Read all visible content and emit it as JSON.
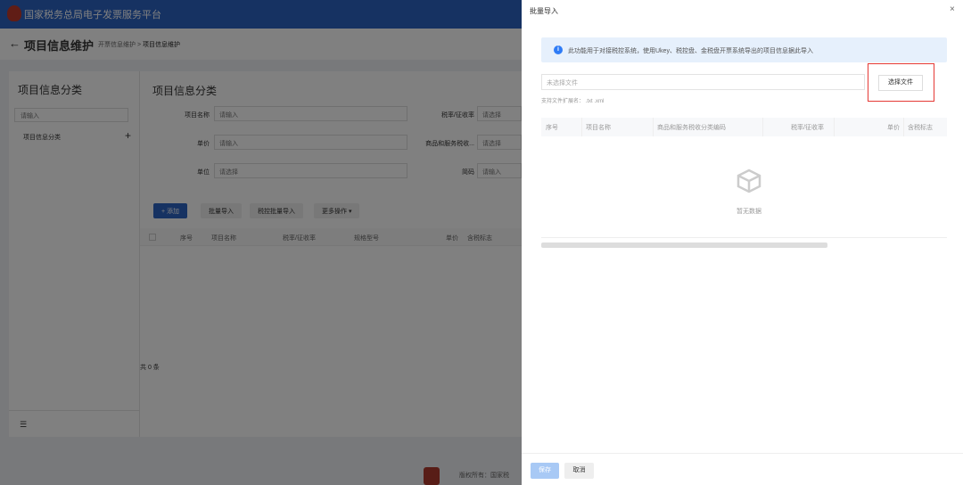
{
  "topbar": {
    "title": "国家税务总局电子发票服务平台"
  },
  "subheader": {
    "title": "项目信息维护",
    "breadcrumb_parent": "开票信息维护",
    "breadcrumb_sep": ">",
    "breadcrumb_current": "项目信息维护",
    "back": "←"
  },
  "left": {
    "heading": "项目信息分类",
    "search_placeholder": "请输入",
    "item": "项目信息分类",
    "plus": "+",
    "collapse": "☰"
  },
  "main": {
    "heading": "项目信息分类",
    "filters": [
      {
        "label": "项目名称",
        "placeholder": "请输入"
      },
      {
        "label": "单价",
        "placeholder": "请输入"
      },
      {
        "label": "单位",
        "placeholder": "请选择"
      }
    ],
    "filters_right": [
      {
        "label": "税率/征收率",
        "placeholder": "请选择"
      },
      {
        "label": "商品和服务税收...",
        "placeholder": "请选择"
      },
      {
        "label": "简码",
        "placeholder": "请输入"
      }
    ],
    "buttons": {
      "add": "+ 添加",
      "batch": "批量导入",
      "tax_batch": "税控批量导入",
      "more": "更多操作 ▾"
    },
    "columns": [
      "序号",
      "项目名称",
      "税率/征收率",
      "规格型号",
      "单价",
      "含税标志"
    ],
    "total": "共 0 条"
  },
  "footer": {
    "text": "版权所有：国家税"
  },
  "drawer": {
    "title": "批量导入",
    "close": "×",
    "alert": "此功能用于对接税控系统，使用Ukey、税控盘、金税盘开票系统导出的项目信息据此导入",
    "file_placeholder": "未选择文件",
    "choose_button": "选择文件",
    "hint": "支持文件扩展名： .txt .xml",
    "columns": [
      "序号",
      "项目名称",
      "商品和服务税收分类编码",
      "税率/征收率",
      "单价",
      "含税标志"
    ],
    "empty": "暂无数据",
    "save": "保存",
    "cancel": "取消"
  }
}
